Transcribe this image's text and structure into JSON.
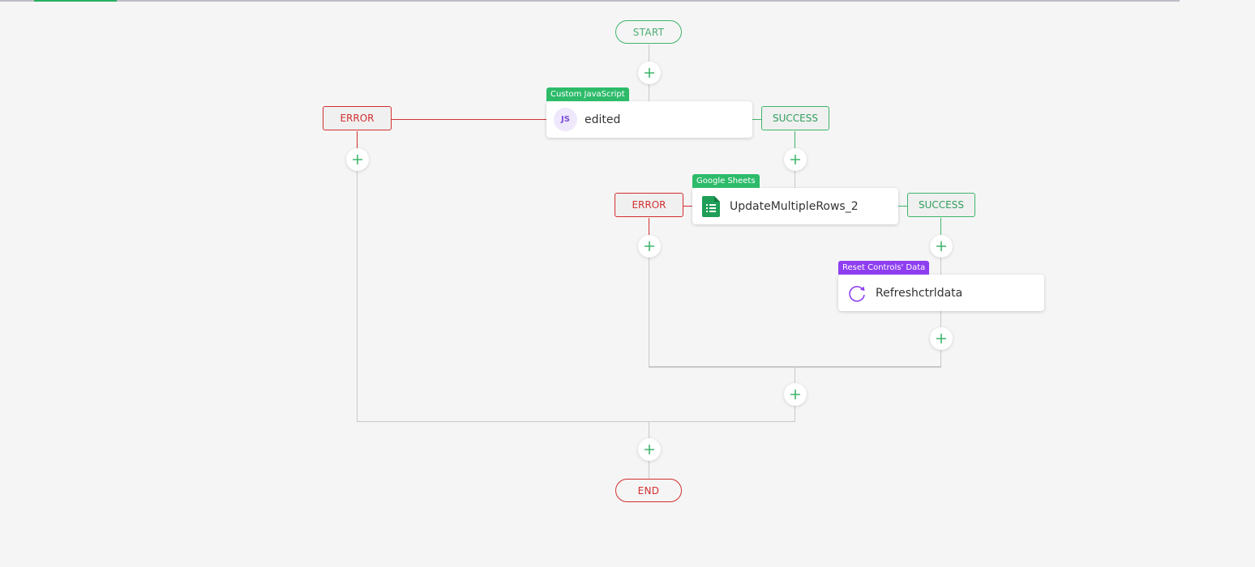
{
  "flow": {
    "start_label": "START",
    "end_label": "END",
    "add_step_tooltip": "+",
    "nodes": [
      {
        "tag": "Custom JavaScript",
        "icon": "js-icon",
        "icon_text": "JS",
        "label": "edited"
      },
      {
        "tag": "Google Sheets",
        "icon": "google-sheets-icon",
        "label": "UpdateMultipleRows_2"
      },
      {
        "tag": "Reset Controls' Data",
        "icon": "refresh-icon",
        "label": "Refreshctrldata"
      }
    ],
    "branches": {
      "error_label": "ERROR",
      "success_label": "SUCCESS"
    }
  },
  "colors": {
    "success": "#3fb56b",
    "error": "#d32f2f",
    "tag_green": "#2dbb6a",
    "tag_purple": "#8e3ef0",
    "background": "#f5f5f5"
  }
}
